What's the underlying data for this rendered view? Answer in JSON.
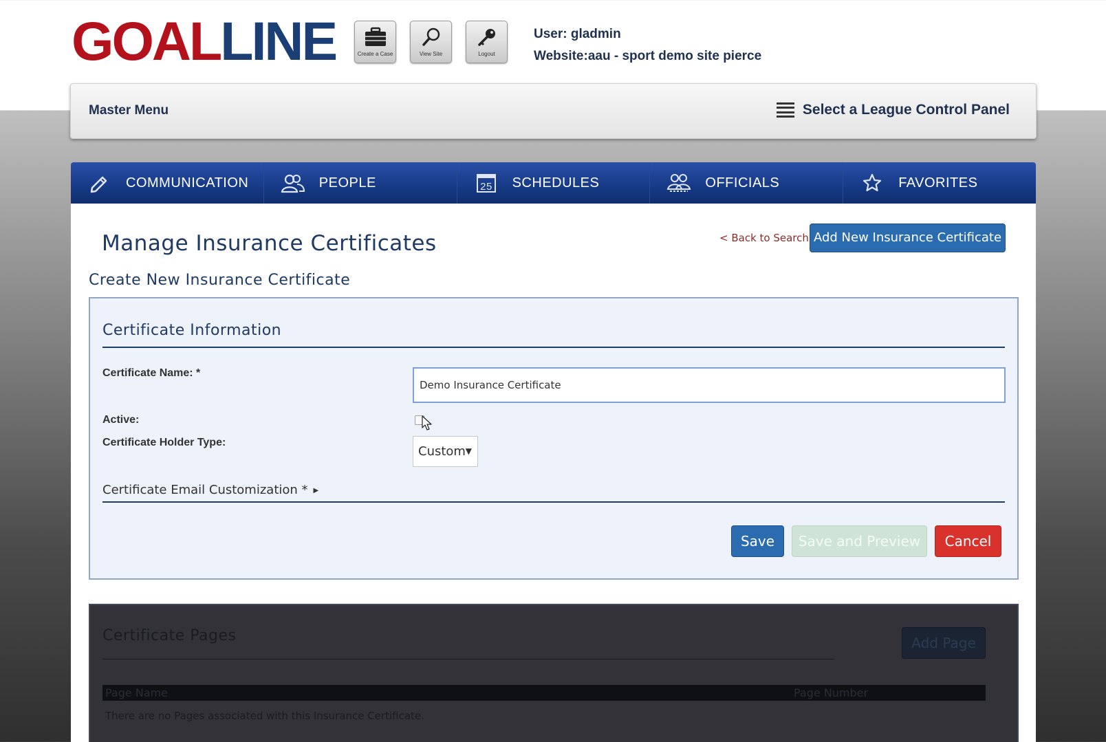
{
  "header": {
    "logo_part1": "GOAL",
    "logo_part2": "LINE",
    "tools": [
      {
        "label": "Create a Case",
        "icon": "briefcase-icon"
      },
      {
        "label": "View Site",
        "icon": "magnifier-icon"
      },
      {
        "label": "Logout",
        "icon": "key-icon"
      }
    ],
    "user_line": "User: gladmin",
    "website_line": "Website:aau - sport demo site pierce"
  },
  "master_bar": {
    "left_label": "Master Menu",
    "right_label": "Select a League Control Panel"
  },
  "nav": {
    "items": [
      {
        "label": "COMMUNICATION",
        "icon": "pencil-icon"
      },
      {
        "label": "PEOPLE",
        "icon": "people-icon"
      },
      {
        "label": "SCHEDULES",
        "icon": "calendar-icon",
        "icon_text": "25"
      },
      {
        "label": "OFFICIALS",
        "icon": "officials-icon"
      },
      {
        "label": "FAVORITES",
        "icon": "star-icon"
      }
    ]
  },
  "main": {
    "page_title": "Manage Insurance Certificates",
    "back_link": "< Back to Search",
    "add_button": "Add New Insurance Certificate",
    "sub_title": "Create New Insurance Certificate"
  },
  "form": {
    "section_title": "Certificate Information",
    "name_label": "Certificate Name: *",
    "name_value": "Demo Insurance Certificate",
    "active_label": "Active:",
    "active_checked": false,
    "holder_label": "Certificate Holder Type:",
    "holder_value": "Custom",
    "email_custom_label": "Certificate Email Customization *",
    "save_label": "Save",
    "save_preview_label": "Save and Preview",
    "cancel_label": "Cancel"
  },
  "pages": {
    "section_title": "Certificate Pages",
    "add_page_label": "Add Page",
    "columns": [
      "Page Name",
      "Page Number"
    ],
    "empty_message": "There are no Pages associated with this Insurance Certificate."
  },
  "colors": {
    "brand_red": "#b3121c",
    "brand_blue": "#1b3f75",
    "nav_blue": "#163a86",
    "primary_button": "#2b6cb0",
    "cancel_button": "#d9322c"
  }
}
